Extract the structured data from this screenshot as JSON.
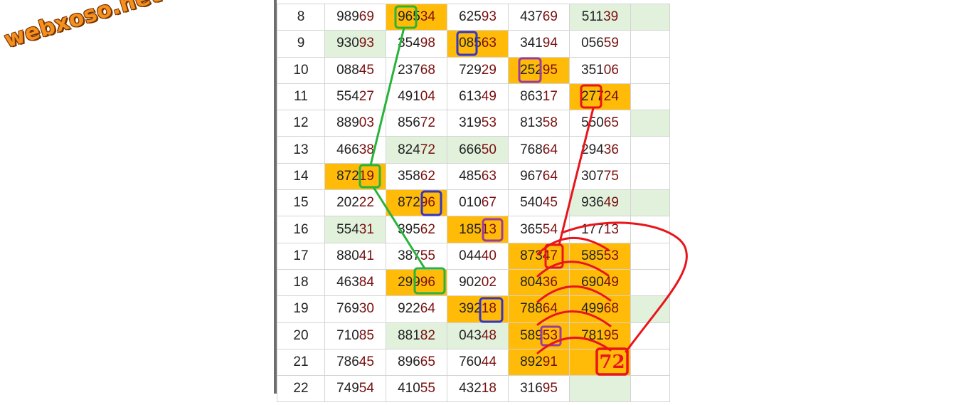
{
  "logo": {
    "text": "webxoso.net"
  },
  "rows": [
    {
      "no": "8",
      "cells": [
        {
          "head": "989",
          "tail": "69",
          "bg": ""
        },
        {
          "head": "965",
          "tail": "34",
          "bg": "y"
        },
        {
          "head": "625",
          "tail": "93",
          "bg": ""
        },
        {
          "head": "437",
          "tail": "69",
          "bg": ""
        },
        {
          "head": "511",
          "tail": "39",
          "bg": "g"
        }
      ]
    },
    {
      "no": "9",
      "cells": [
        {
          "head": "930",
          "tail": "93",
          "bg": "g"
        },
        {
          "head": "354",
          "tail": "98",
          "bg": ""
        },
        {
          "head": "085",
          "tail": "63",
          "bg": "y"
        },
        {
          "head": "341",
          "tail": "94",
          "bg": ""
        },
        {
          "head": "056",
          "tail": "59",
          "bg": ""
        }
      ]
    },
    {
      "no": "10",
      "cells": [
        {
          "head": "088",
          "tail": "45",
          "bg": ""
        },
        {
          "head": "237",
          "tail": "68",
          "bg": ""
        },
        {
          "head": "729",
          "tail": "29",
          "bg": ""
        },
        {
          "head": "252",
          "tail": "95",
          "bg": "y"
        },
        {
          "head": "351",
          "tail": "06",
          "bg": ""
        }
      ]
    },
    {
      "no": "11",
      "cells": [
        {
          "head": "554",
          "tail": "27",
          "bg": ""
        },
        {
          "head": "491",
          "tail": "04",
          "bg": ""
        },
        {
          "head": "613",
          "tail": "49",
          "bg": ""
        },
        {
          "head": "863",
          "tail": "17",
          "bg": ""
        },
        {
          "head": "277",
          "tail": "24",
          "bg": "y"
        }
      ]
    },
    {
      "no": "12",
      "cells": [
        {
          "head": "889",
          "tail": "03",
          "bg": ""
        },
        {
          "head": "856",
          "tail": "72",
          "bg": ""
        },
        {
          "head": "319",
          "tail": "53",
          "bg": ""
        },
        {
          "head": "813",
          "tail": "58",
          "bg": ""
        },
        {
          "head": "550",
          "tail": "65",
          "bg": ""
        }
      ]
    },
    {
      "no": "13",
      "cells": [
        {
          "head": "466",
          "tail": "38",
          "bg": ""
        },
        {
          "head": "824",
          "tail": "72",
          "bg": "g"
        },
        {
          "head": "666",
          "tail": "50",
          "bg": "g"
        },
        {
          "head": "768",
          "tail": "64",
          "bg": ""
        },
        {
          "head": "294",
          "tail": "36",
          "bg": ""
        }
      ]
    },
    {
      "no": "14",
      "cells": [
        {
          "head": "872",
          "tail": "19",
          "bg": "y"
        },
        {
          "head": "358",
          "tail": "62",
          "bg": ""
        },
        {
          "head": "485",
          "tail": "63",
          "bg": ""
        },
        {
          "head": "967",
          "tail": "64",
          "bg": ""
        },
        {
          "head": "307",
          "tail": "75",
          "bg": ""
        }
      ]
    },
    {
      "no": "15",
      "cells": [
        {
          "head": "202",
          "tail": "22",
          "bg": ""
        },
        {
          "head": "872",
          "tail": "96",
          "bg": "y"
        },
        {
          "head": "010",
          "tail": "67",
          "bg": ""
        },
        {
          "head": "540",
          "tail": "45",
          "bg": ""
        },
        {
          "head": "936",
          "tail": "49",
          "bg": "g"
        }
      ]
    },
    {
      "no": "16",
      "cells": [
        {
          "head": "554",
          "tail": "31",
          "bg": "g"
        },
        {
          "head": "395",
          "tail": "62",
          "bg": ""
        },
        {
          "head": "185",
          "tail": "13",
          "bg": "y"
        },
        {
          "head": "365",
          "tail": "54",
          "bg": ""
        },
        {
          "head": "177",
          "tail": "13",
          "bg": ""
        }
      ]
    },
    {
      "no": "17",
      "cells": [
        {
          "head": "880",
          "tail": "41",
          "bg": ""
        },
        {
          "head": "387",
          "tail": "55",
          "bg": ""
        },
        {
          "head": "044",
          "tail": "40",
          "bg": ""
        },
        {
          "head": "873",
          "tail": "47",
          "bg": "y"
        },
        {
          "head": "585",
          "tail": "53",
          "bg": "y"
        }
      ]
    },
    {
      "no": "18",
      "cells": [
        {
          "head": "463",
          "tail": "84",
          "bg": ""
        },
        {
          "head": "299",
          "tail": "96",
          "bg": "y"
        },
        {
          "head": "902",
          "tail": "02",
          "bg": ""
        },
        {
          "head": "804",
          "tail": "36",
          "bg": "y"
        },
        {
          "head": "690",
          "tail": "49",
          "bg": "y"
        }
      ]
    },
    {
      "no": "19",
      "cells": [
        {
          "head": "769",
          "tail": "30",
          "bg": ""
        },
        {
          "head": "922",
          "tail": "64",
          "bg": ""
        },
        {
          "head": "392",
          "tail": "18",
          "bg": "y"
        },
        {
          "head": "788",
          "tail": "64",
          "bg": "y"
        },
        {
          "head": "499",
          "tail": "68",
          "bg": "y"
        }
      ]
    },
    {
      "no": "20",
      "cells": [
        {
          "head": "710",
          "tail": "85",
          "bg": ""
        },
        {
          "head": "881",
          "tail": "82",
          "bg": "g"
        },
        {
          "head": "043",
          "tail": "48",
          "bg": "g"
        },
        {
          "head": "589",
          "tail": "53",
          "bg": "y"
        },
        {
          "head": "781",
          "tail": "95",
          "bg": "y"
        }
      ]
    },
    {
      "no": "21",
      "cells": [
        {
          "head": "786",
          "tail": "45",
          "bg": ""
        },
        {
          "head": "896",
          "tail": "65",
          "bg": ""
        },
        {
          "head": "760",
          "tail": "44",
          "bg": ""
        },
        {
          "head": "892",
          "tail": "91",
          "bg": "y"
        },
        {
          "head": "",
          "tail": "",
          "bg": "y"
        }
      ]
    },
    {
      "no": "22",
      "cells": [
        {
          "head": "749",
          "tail": "54",
          "bg": ""
        },
        {
          "head": "410",
          "tail": "55",
          "bg": ""
        },
        {
          "head": "432",
          "tail": "18",
          "bg": ""
        },
        {
          "head": "316",
          "tail": "95",
          "bg": ""
        },
        {
          "head": "",
          "tail": "",
          "bg": "g"
        }
      ]
    }
  ],
  "extra_green_rows": [
    0,
    4,
    7,
    11
  ],
  "prediction": {
    "text": "72"
  },
  "colors": {
    "yellow": "#ffbb08",
    "green_bg": "#e1f1dc",
    "row_number": "#1515d8",
    "tail_digits": "#7a0f0f",
    "green_mark": "#27b43a",
    "blue_mark": "#3434c8",
    "purple_mark": "#9b3c9b",
    "red_mark": "#e8151b"
  }
}
